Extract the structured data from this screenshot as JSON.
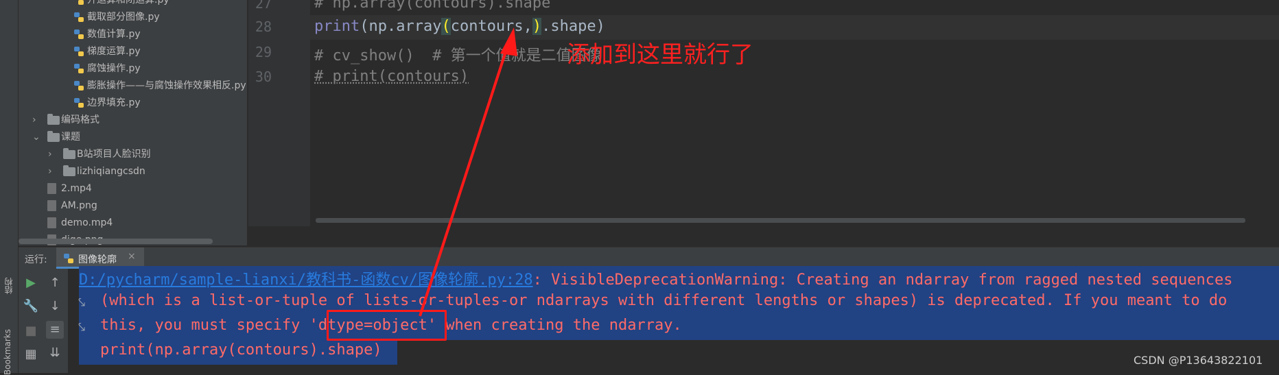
{
  "left_strip": {
    "structure_label": "结构",
    "bookmarks_label": "Bookmarks"
  },
  "project_tree": {
    "items": [
      {
        "label": "开运算和闭运算.py",
        "kind": "py"
      },
      {
        "label": "截取部分图像.py",
        "kind": "py"
      },
      {
        "label": "数值计算.py",
        "kind": "py"
      },
      {
        "label": "梯度运算.py",
        "kind": "py"
      },
      {
        "label": "腐蚀操作.py",
        "kind": "py"
      },
      {
        "label": "膨胀操作——与腐蚀操作效果相反.py",
        "kind": "py"
      },
      {
        "label": "边界填充.py",
        "kind": "py"
      },
      {
        "label": "编码格式",
        "kind": "folder"
      },
      {
        "label": "课题",
        "kind": "folder"
      },
      {
        "label": "B站项目人脸识别",
        "kind": "folder"
      },
      {
        "label": "lizhiqiangcsdn",
        "kind": "folder"
      },
      {
        "label": "2.mp4",
        "kind": "file"
      },
      {
        "label": "AM.png",
        "kind": "file"
      },
      {
        "label": "demo.mp4",
        "kind": "file"
      },
      {
        "label": "dige.png",
        "kind": "file"
      }
    ]
  },
  "editor": {
    "line_numbers": [
      "27",
      "28",
      "29",
      "30"
    ],
    "line27": "# np.array(contours).shape",
    "line28_kw": "print",
    "line28_a": "(np.array",
    "line28_paren": "(",
    "line28_b": "contours,",
    "line28_paren2": ")",
    "line28_c": ".shape)",
    "line29": "# cv_show()  # 第一个值就是二值图像",
    "line30": "# print(contours)"
  },
  "run_panel": {
    "run_label": "运行:",
    "tab_label": "图像轮廓",
    "close_glyph": "×"
  },
  "console": {
    "link": "D:/pycharm/sample-lianxi/教科书-函数cv/图像轮廓.py:28",
    "line1_rest": ": VisibleDeprecationWarning: Creating an ndarray from ragged nested sequences",
    "line2": "(which is a list-or-tuple of lists-or-tuples-or ndarrays with different lengths or shapes) is deprecated. If you meant to do",
    "line3": "this, you must specify 'dtype=object' when creating the ndarray.",
    "line4": "print(np.array(contours).shape)"
  },
  "annotation": {
    "text": "添加到这里就行了"
  },
  "watermark": "CSDN @P13643822101",
  "colors": {
    "arrow": "#ff1a1a",
    "selection": "#214283",
    "error_text": "#ff6b68"
  }
}
